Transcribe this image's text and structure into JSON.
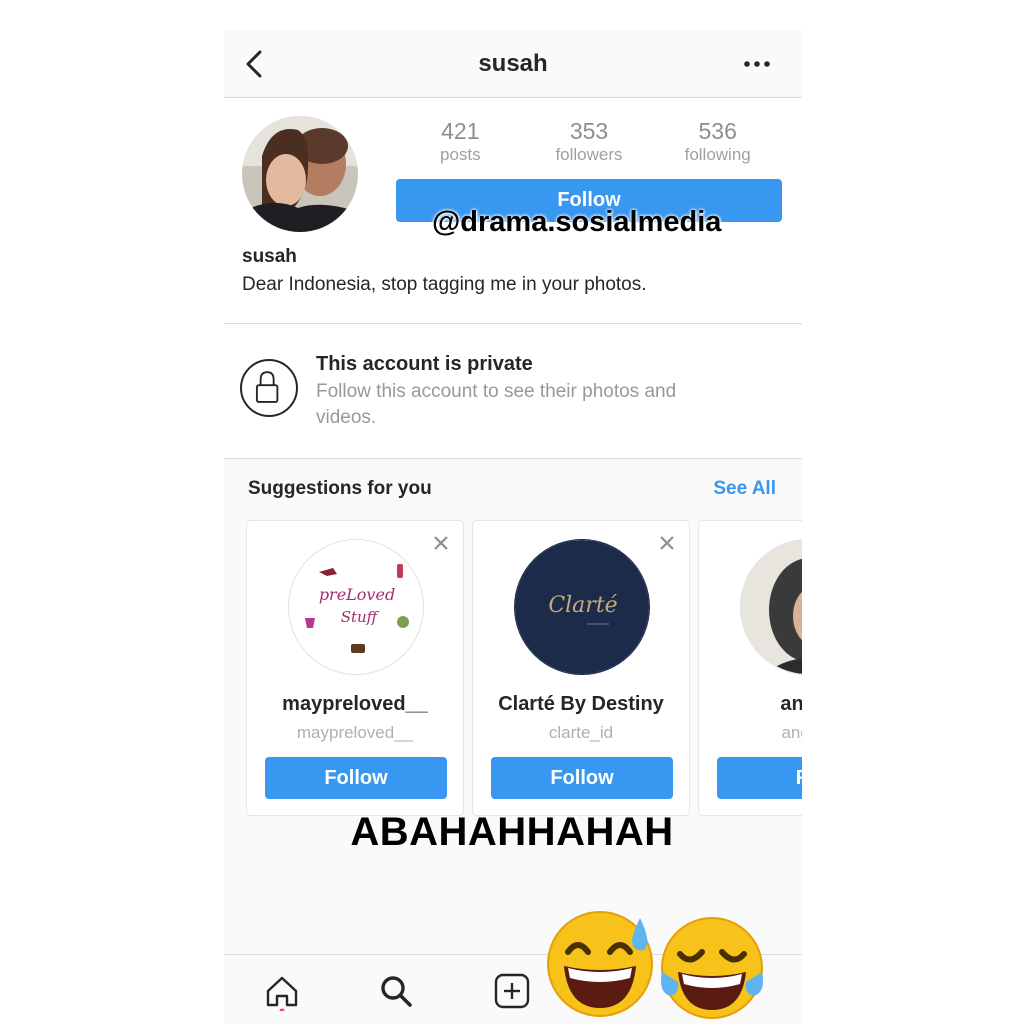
{
  "header": {
    "title": "susah"
  },
  "profile": {
    "stats": [
      {
        "value": "421",
        "label": "posts"
      },
      {
        "value": "353",
        "label": "followers"
      },
      {
        "value": "536",
        "label": "following"
      }
    ],
    "follow_label": "Follow",
    "username": "susah",
    "bio": "Dear Indonesia, stop tagging me in your photos."
  },
  "private_notice": {
    "title": "This account is private",
    "description": "Follow this account to see their photos and videos."
  },
  "suggestions": {
    "title": "Suggestions for you",
    "see_all": "See All",
    "cards": [
      {
        "name": "maypreloved__",
        "handle": "maypreloved__",
        "follow": "Follow",
        "logo_text_1": "preLoved",
        "logo_text_2": "Stuff"
      },
      {
        "name": "Clarté By Destiny",
        "handle": "clarte_id",
        "follow": "Follow",
        "logo_text_1": "Clarté"
      },
      {
        "name": "anggi",
        "handle": "anggin",
        "follow": "Fo"
      }
    ]
  },
  "overlay": {
    "watermark": "@drama.sosialmedia",
    "caption": "ABAHAHHAHAH"
  },
  "colors": {
    "accent": "#3897f0",
    "border": "#dbdbdb",
    "clarte_bg": "#1c2b4a"
  },
  "icons": [
    "back-icon",
    "more-icon",
    "lock-icon",
    "close-icon",
    "home-icon",
    "search-icon",
    "add-icon",
    "sweat-smile-emoji",
    "tears-of-joy-emoji"
  ]
}
